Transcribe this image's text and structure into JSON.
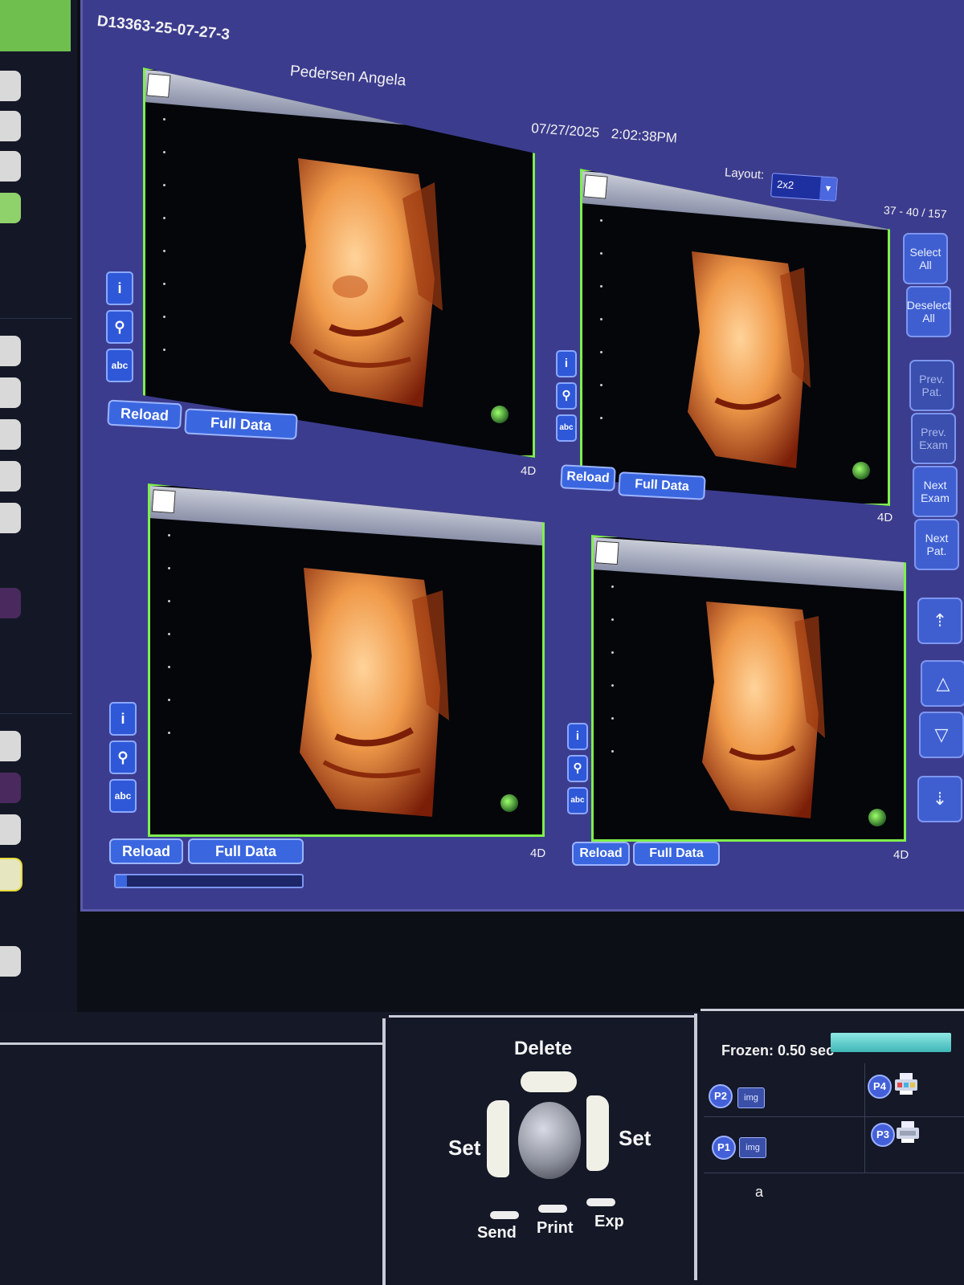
{
  "header": {
    "exam_id": "D13363-25-07-27-3",
    "patient_name": "Pedersen Angela",
    "date": "07/27/2025",
    "time": "2:02:38PM",
    "layout_label": "Layout:",
    "layout_value": "2x2",
    "page_count": "37 - 40 / 157"
  },
  "side_buttons": {
    "select_all": "Select All",
    "deselect_all": "Deselect All",
    "prev_pat": "Prev. Pat.",
    "prev_exam": "Prev. Exam",
    "next_exam": "Next Exam",
    "next_pat": "Next Pat.",
    "first_icon": "first-page-icon",
    "up_icon": "up-arrow-icon",
    "down_icon": "down-arrow-icon",
    "last_icon": "last-page-icon"
  },
  "images": [
    {
      "reload": "Reload",
      "full_data": "Full Data",
      "mode": "4D"
    },
    {
      "reload": "Reload",
      "full_data": "Full Data",
      "mode": "4D"
    },
    {
      "reload": "Reload",
      "full_data": "Full Data",
      "mode": "4D"
    },
    {
      "reload": "Reload",
      "full_data": "Full Data",
      "mode": "4D"
    }
  ],
  "tool_icons": {
    "info": "i",
    "probe": "probe-icon",
    "text": "abc"
  },
  "controls": {
    "delete": "Delete",
    "set_left": "Set",
    "set_right": "Set",
    "send": "Send",
    "print": "Print",
    "exp": "Exp",
    "frozen_label": "Frozen:",
    "frozen_value": "0.50 sec",
    "p2": "P2",
    "p1": "P1",
    "p4": "P4",
    "p3": "P3",
    "img": "img",
    "a": "a"
  },
  "colors": {
    "panel": "#3c3c8e",
    "frame_border": "#7ff04c",
    "button": "#3a66e0",
    "frozen_bar": "#5fd0cf"
  }
}
